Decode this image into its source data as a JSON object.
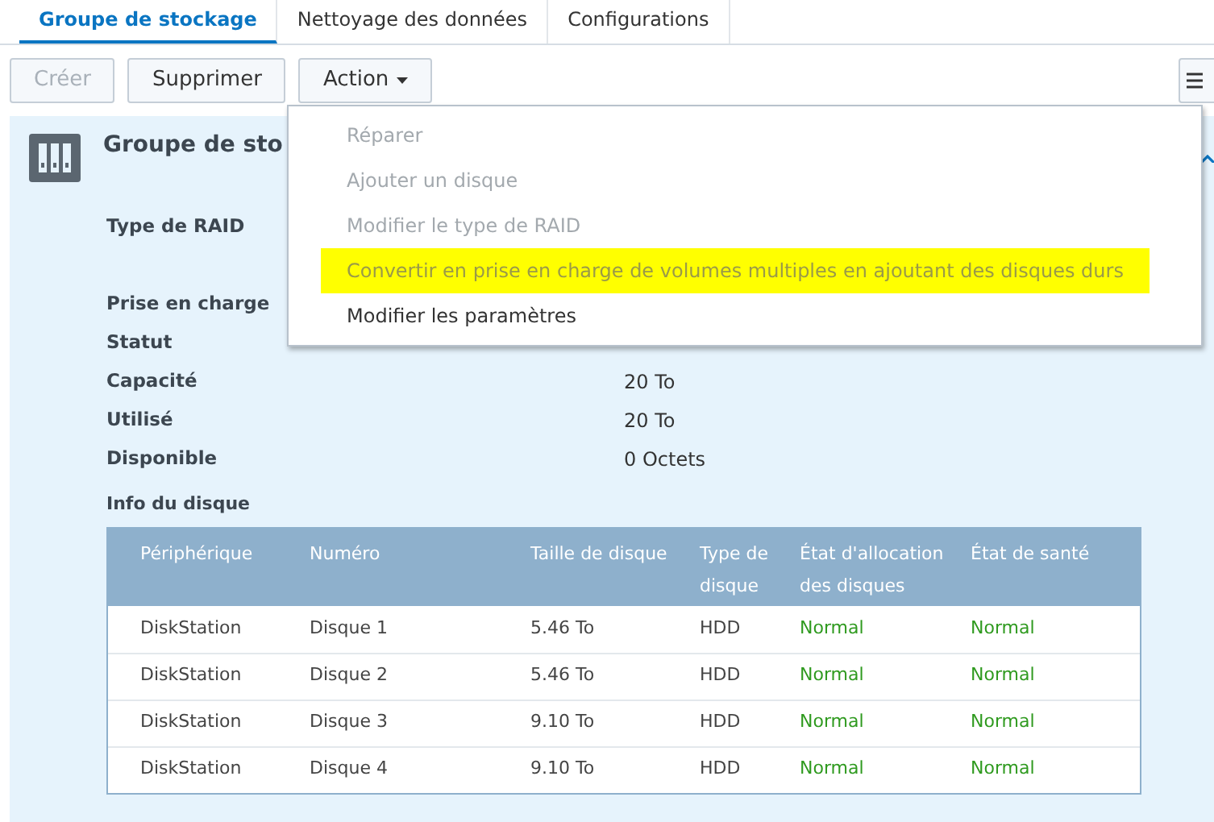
{
  "tabs": [
    {
      "label": "Groupe de stockage",
      "selected": true
    },
    {
      "label": "Nettoyage des données",
      "selected": false
    },
    {
      "label": "Configurations",
      "selected": false
    }
  ],
  "toolbar": {
    "buttons": [
      {
        "label": "Créer",
        "disabled": true
      },
      {
        "label": "Supprimer",
        "disabled": false
      }
    ],
    "action_button": {
      "label": "Action"
    }
  },
  "action_menu": {
    "items": [
      {
        "label": "Réparer",
        "disabled": true,
        "highlighted": false
      },
      {
        "label": "Ajouter un disque",
        "disabled": true,
        "highlighted": false
      },
      {
        "label": "Modifier le type de RAID",
        "disabled": true,
        "highlighted": false
      },
      {
        "label": "Convertir en prise en charge de volumes multiples en ajoutant des disques durs",
        "disabled": true,
        "highlighted": true
      },
      {
        "label": "Modifier les paramètres",
        "disabled": false,
        "highlighted": false
      }
    ]
  },
  "panel": {
    "title": "Groupe de sto",
    "properties": [
      {
        "label": "Type de RAID"
      },
      {
        "label": "Prise en charge"
      },
      {
        "label": "Statut"
      },
      {
        "label": "Capacité",
        "value": "20 To"
      },
      {
        "label": "Utilisé",
        "value": "20 To"
      },
      {
        "label": "Disponible",
        "value": "0 Octets"
      }
    ],
    "disk_info": {
      "title": "Info du disque",
      "columns": [
        "Périphérique",
        "Numéro",
        "Taille de disque",
        "Type de disque",
        "État d'allocation des disques",
        "État de santé"
      ],
      "rows": [
        [
          "DiskStation",
          "Disque 1",
          "5.46 To",
          "HDD",
          "Normal",
          "Normal"
        ],
        [
          "DiskStation",
          "Disque 2",
          "5.46 To",
          "HDD",
          "Normal",
          "Normal"
        ],
        [
          "DiskStation",
          "Disque 3",
          "9.10 To",
          "HDD",
          "Normal",
          "Normal"
        ],
        [
          "DiskStation",
          "Disque 4",
          "9.10 To",
          "HDD",
          "Normal",
          "Normal"
        ]
      ]
    }
  }
}
